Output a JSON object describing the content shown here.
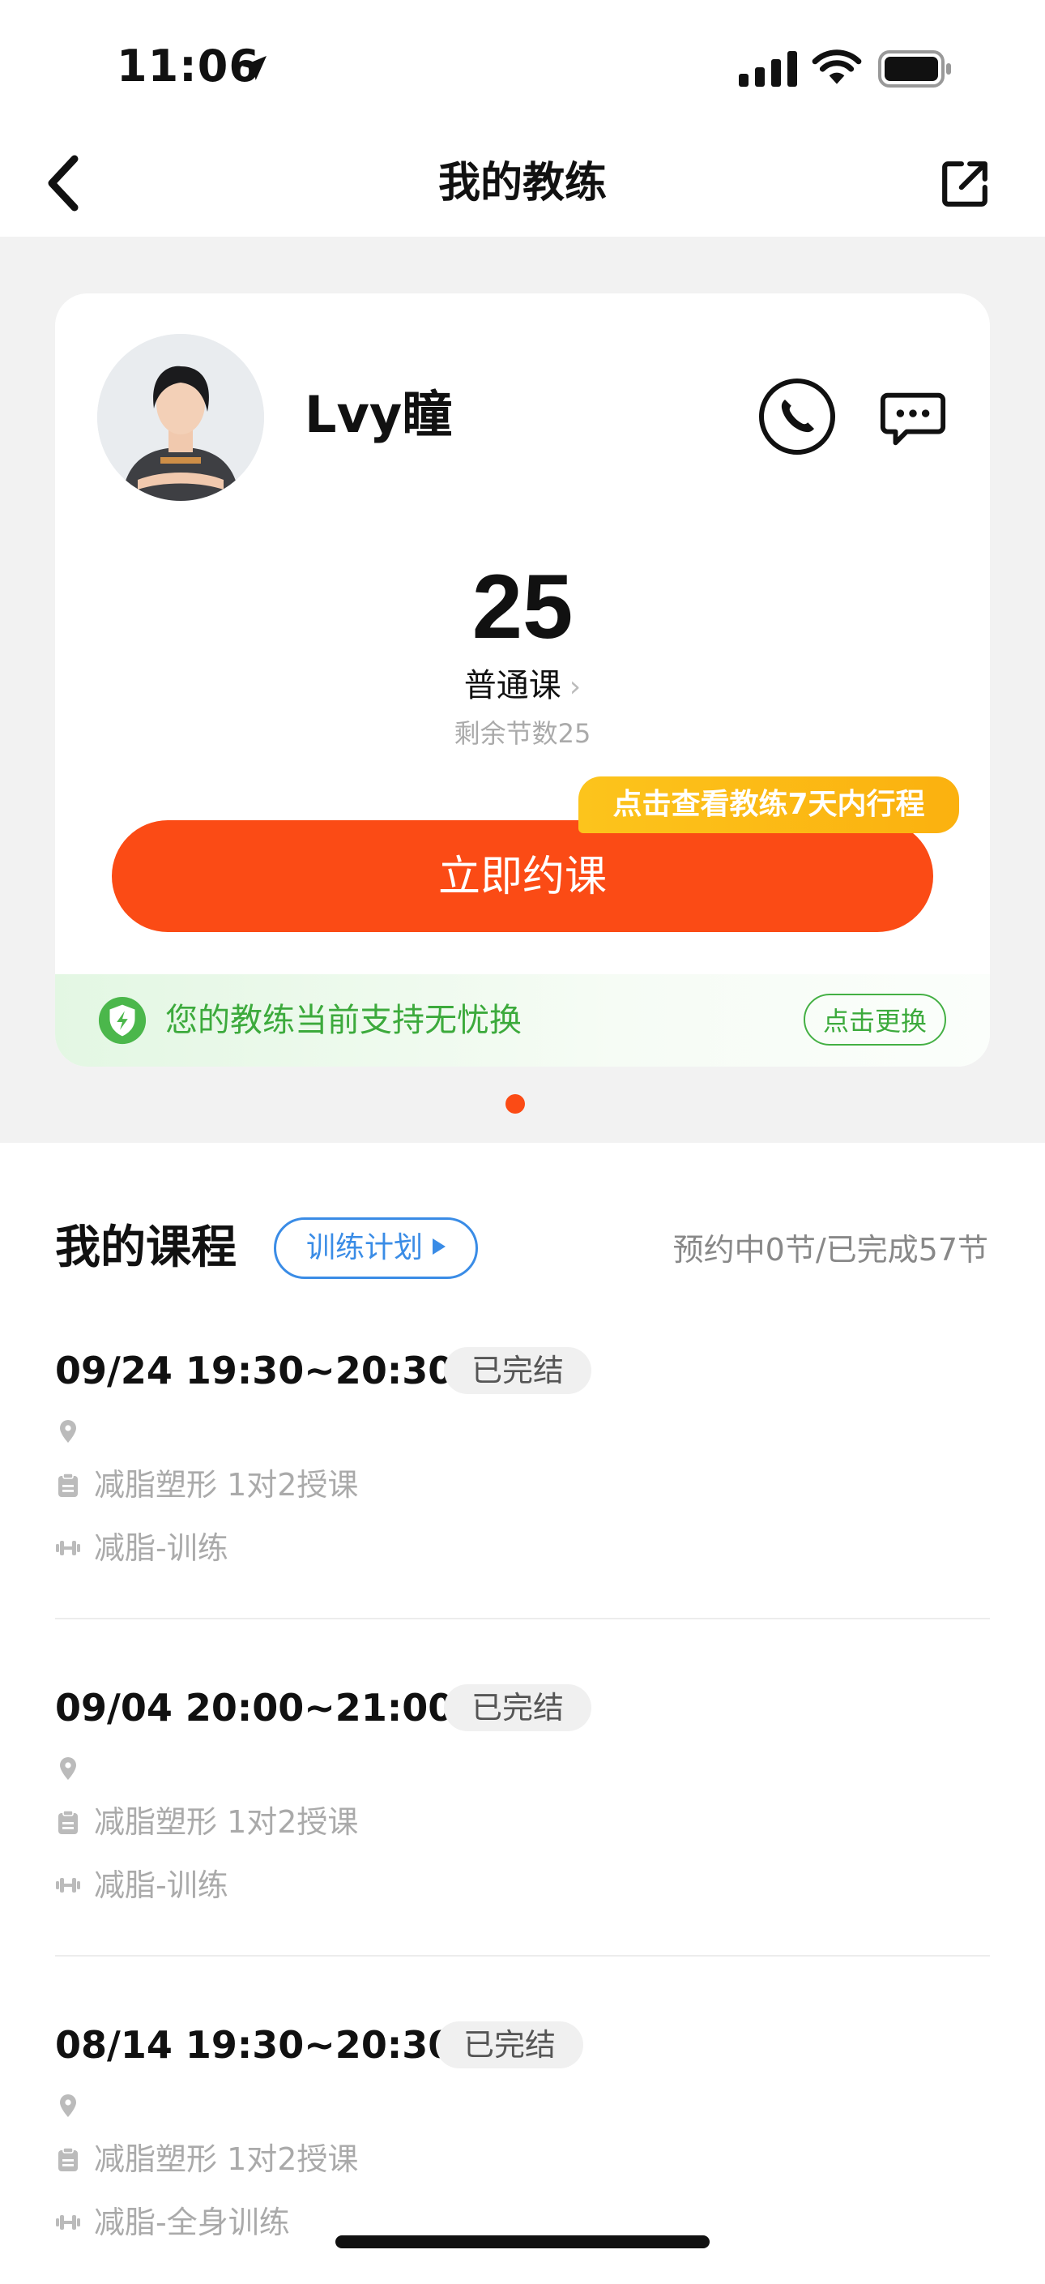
{
  "status_bar": {
    "time": "11:06"
  },
  "nav": {
    "title": "我的教练"
  },
  "coach": {
    "name": "Lvy瞳",
    "lesson_count": "25",
    "lesson_type": "普通课",
    "remaining_label": "剩余节数25",
    "schedule_tag": "点击查看教练7天内行程",
    "book_label": "立即约课",
    "guarantee_text": "您的教练当前支持无忧换",
    "change_label": "点击更换"
  },
  "courses": {
    "title": "我的课程",
    "plan_label": "训练计划",
    "stats": "预约中0节/已完成57节",
    "items": [
      {
        "time": "09/24 19:30~20:30",
        "status": "已完结",
        "location": "",
        "course": "减脂塑形 1对2授课",
        "focus": "减脂-训练"
      },
      {
        "time": "09/04 20:00~21:00",
        "status": "已完结",
        "location": "",
        "course": "减脂塑形 1对2授课",
        "focus": "减脂-训练"
      },
      {
        "time": "08/14 19:30~20:30",
        "status": "已完结",
        "location": "",
        "course": "减脂塑形 1对2授课",
        "focus": "减脂-全身训练"
      }
    ]
  },
  "colors": {
    "accent_orange": "#fb4b15",
    "tag_yellow": "#fbb10f",
    "guarantee_green": "#3caa3c",
    "plan_blue": "#3a8ce6"
  },
  "icons": {
    "location": "navigation-arrow-icon",
    "back": "chevron-left-icon",
    "share": "external-link-icon",
    "phone": "phone-icon",
    "chat": "chat-bubble-icon",
    "shield": "shield-icon",
    "pin": "map-pin-icon",
    "clipboard": "clipboard-icon",
    "dumbbell": "dumbbell-icon"
  }
}
